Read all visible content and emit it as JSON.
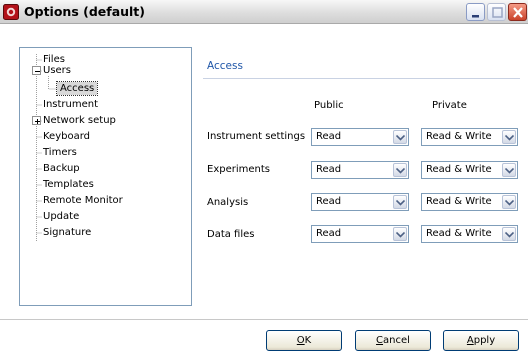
{
  "window": {
    "title": "Options (default)"
  },
  "tree": {
    "items": [
      {
        "label": "Files"
      },
      {
        "label": "Users"
      },
      {
        "label": "Access"
      },
      {
        "label": "Instrument"
      },
      {
        "label": "Network setup"
      },
      {
        "label": "Keyboard"
      },
      {
        "label": "Timers"
      },
      {
        "label": "Backup"
      },
      {
        "label": "Templates"
      },
      {
        "label": "Remote Monitor"
      },
      {
        "label": "Update"
      },
      {
        "label": "Signature"
      }
    ]
  },
  "panel": {
    "title": "Access",
    "columns": [
      "Public",
      "Private"
    ],
    "rows": [
      {
        "label": "Instrument settings",
        "public": "Read",
        "private": "Read & Write"
      },
      {
        "label": "Experiments",
        "public": "Read",
        "private": "Read & Write"
      },
      {
        "label": "Analysis",
        "public": "Read",
        "private": "Read & Write"
      },
      {
        "label": "Data files",
        "public": "Read",
        "private": "Read & Write"
      }
    ]
  },
  "buttons": {
    "ok": {
      "accel": "O",
      "rest": "K"
    },
    "cancel": {
      "accel": "C",
      "rest": "ancel"
    },
    "apply": {
      "accel": "A",
      "rest": "pply"
    }
  },
  "colors": {
    "accent": "#1f56a8",
    "close_button": "#c9432b"
  }
}
